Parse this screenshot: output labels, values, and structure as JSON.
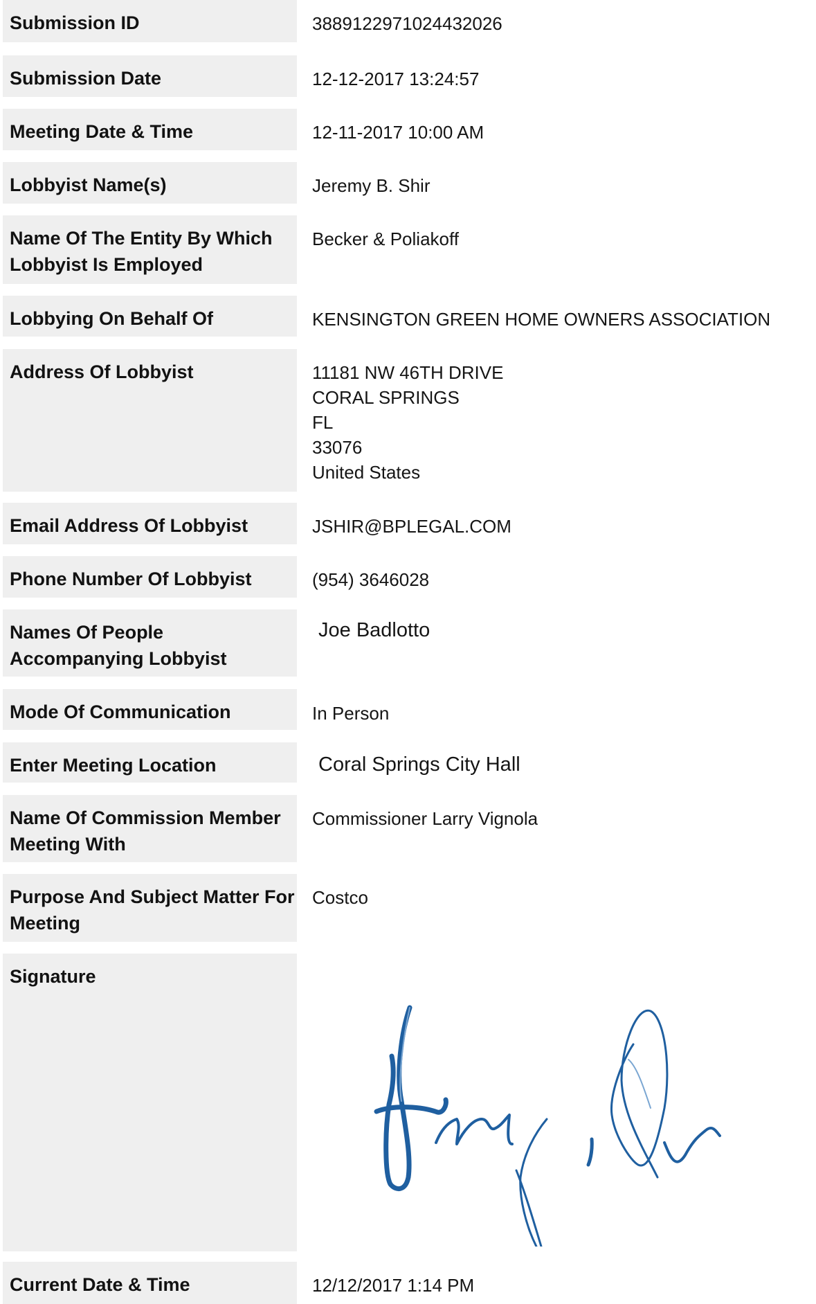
{
  "fields": [
    {
      "label": "Submission ID",
      "value": "3889122971024432026"
    },
    {
      "label": "Submission Date",
      "value": "12-12-2017 13:24:57"
    },
    {
      "label": "Meeting Date & Time",
      "value": "12-11-2017 10:00 AM"
    },
    {
      "label": "Lobbyist Name(s)",
      "value": "Jeremy B. Shir"
    },
    {
      "label": "Name Of The Entity By Which Lobbyist Is Employed",
      "value": "Becker & Poliakoff"
    },
    {
      "label": "Lobbying On Behalf Of",
      "value": "KENSINGTON GREEN HOME OWNERS ASSOCIATION"
    },
    {
      "label": "Address Of Lobbyist",
      "address": [
        "11181 NW 46TH DRIVE",
        "CORAL SPRINGS",
        "FL",
        "33076",
        "United States"
      ]
    },
    {
      "label": "Email Address Of Lobbyist",
      "value": "JSHIR@BPLEGAL.COM"
    },
    {
      "label": "Phone Number Of Lobbyist",
      "value": "(954) 3646028"
    },
    {
      "label": "Names Of People Accompanying Lobbyist",
      "value": "Joe Badlotto"
    },
    {
      "label": "Mode Of Communication",
      "value": "In Person"
    },
    {
      "label": "Enter Meeting Location",
      "value": "Coral Springs City Hall"
    },
    {
      "label": "Name Of Commission Member Meeting With",
      "value": "Commissioner Larry Vignola"
    },
    {
      "label": "Purpose And Subject Matter For Meeting",
      "value": "Costco"
    },
    {
      "label": "Signature"
    },
    {
      "label": "Current Date & Time",
      "value": "12/12/2017 1:14 PM"
    }
  ],
  "colors": {
    "label_background": "#efefef",
    "signature_ink": "#1f5fa0"
  },
  "icons": {
    "signature": "handwritten-signature-image"
  }
}
